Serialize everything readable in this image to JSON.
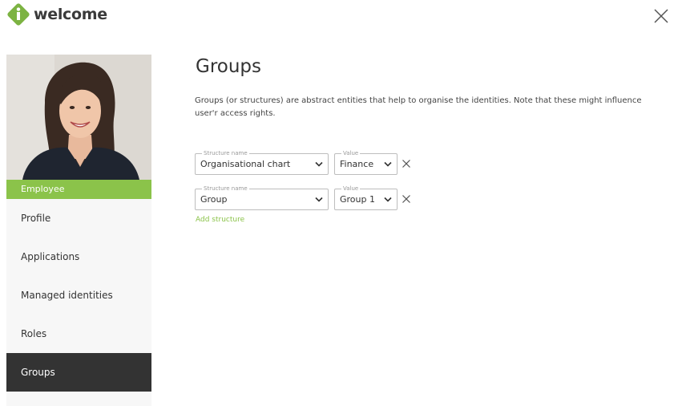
{
  "app": {
    "logo_text": "welcome"
  },
  "sidebar": {
    "role_badge": "Employee",
    "items": [
      {
        "label": "Profile",
        "active": false
      },
      {
        "label": "Applications",
        "active": false
      },
      {
        "label": "Managed identities",
        "active": false
      },
      {
        "label": "Roles",
        "active": false
      },
      {
        "label": "Groups",
        "active": true
      }
    ]
  },
  "main": {
    "title": "Groups",
    "description": "Groups (or structures) are abstract entities that help to organise the identities. Note that these might influence user'r access rights.",
    "structures": [
      {
        "structure_legend": "Structure name",
        "structure_value": "Organisational chart",
        "value_legend": "Value",
        "value": "Finance"
      },
      {
        "structure_legend": "Structure name",
        "structure_value": "Group",
        "value_legend": "Value",
        "value": "Group 1"
      }
    ],
    "add_structure_label": "Add structure"
  },
  "colors": {
    "accent": "#8bc34a",
    "active_nav_bg": "#333333",
    "sidebar_bg": "#f7f7f7"
  },
  "icons": [
    "welcome-logo-icon",
    "close-icon",
    "chevron-down-icon",
    "remove-x-icon"
  ]
}
